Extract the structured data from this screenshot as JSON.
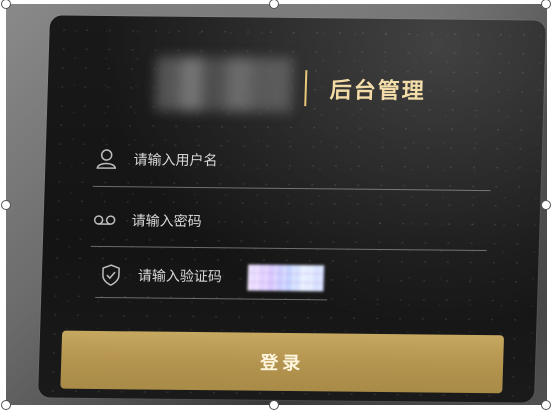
{
  "header": {
    "title": "后台管理",
    "logo_text": ""
  },
  "form": {
    "username": {
      "placeholder": "请输入用户名",
      "icon": "user-icon"
    },
    "password": {
      "placeholder": "请输入密码",
      "icon": "voicemail-icon"
    },
    "captcha": {
      "placeholder": "请输入验证码",
      "icon": "shield-icon"
    }
  },
  "actions": {
    "login_label": "登录"
  },
  "colors": {
    "panel_bg": "#171717",
    "accent_gold": "#b69650",
    "title_gold": "#f1d79a"
  }
}
